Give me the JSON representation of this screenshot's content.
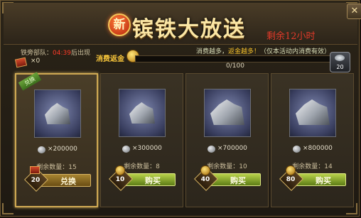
{
  "header": {
    "new_badge": "新",
    "title": "镔铁大放送",
    "remaining": "剩余12小时",
    "close_icon": "close-icon"
  },
  "team": {
    "label_prefix": "铁旁部队：",
    "time": "04:39",
    "label_suffix": "后出现",
    "ticket_count": "×0"
  },
  "consume": {
    "label": "消费返金",
    "promo_pre": "消费越多，",
    "promo_hl": "返金越多！",
    "promo_post": "（仅本活动内消费有效）",
    "progress_text": "0/100",
    "progress_fraction": 0.0,
    "reward_count": "20"
  },
  "cards": [
    {
      "tag": "兑换",
      "qty": "×200000",
      "stock": "剩余数量：15",
      "price": "20",
      "action": "兑换",
      "big": false
    },
    {
      "qty": "×300000",
      "stock": "剩余数量：8",
      "price": "10",
      "action": "购买",
      "big": false
    },
    {
      "qty": "×700000",
      "stock": "剩余数量：10",
      "price": "40",
      "action": "购买",
      "big": true
    },
    {
      "qty": "×800000",
      "stock": "剩余数量：14",
      "price": "80",
      "action": "购买",
      "big": true
    }
  ],
  "colors": {
    "accent": "#fbe6a4",
    "timer": "#e23a2a",
    "gold": "#f6c43a"
  }
}
